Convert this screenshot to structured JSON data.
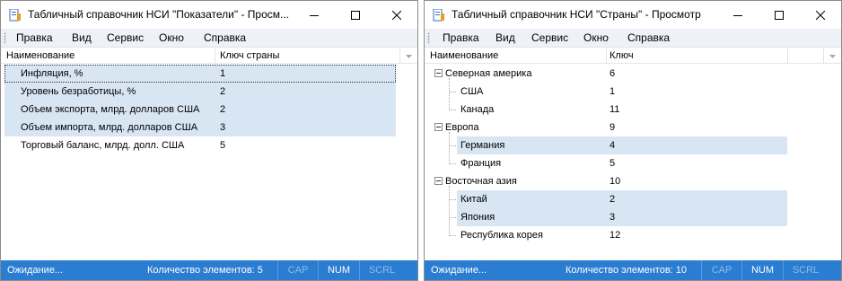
{
  "windows": [
    {
      "title": "Табличный справочник НСИ \"Показатели\" - Просм...",
      "menu": [
        "Правка",
        "Вид",
        "Сервис",
        "Окно",
        "Справка"
      ],
      "columns": [
        "Наименование",
        "Ключ страны"
      ],
      "rows": [
        {
          "name": "Инфляция, %",
          "key": "1"
        },
        {
          "name": "Уровень безработицы, %",
          "key": "2"
        },
        {
          "name": "Объем экспорта, млрд. долларов США",
          "key": "2"
        },
        {
          "name": "Объем импорта, млрд. долларов США",
          "key": "3"
        },
        {
          "name": "Торговый баланс, млрд. долл. США",
          "key": "5"
        }
      ],
      "status": "Ожидание...",
      "count": "Количество элементов: 5",
      "indicators": [
        "CAP",
        "NUM",
        "SCRL"
      ]
    },
    {
      "title": "Табличный справочник НСИ \"Страны\" - Просмотр",
      "menu": [
        "Правка",
        "Вид",
        "Сервис",
        "Окно",
        "Справка"
      ],
      "columns": [
        "Наименование",
        "Ключ"
      ],
      "rows": [
        {
          "name": "Северная америка",
          "key": "6"
        },
        {
          "name": "США",
          "key": "1"
        },
        {
          "name": "Канада",
          "key": "11"
        },
        {
          "name": "Европа",
          "key": "9"
        },
        {
          "name": "Германия",
          "key": "4"
        },
        {
          "name": "Франция",
          "key": "5"
        },
        {
          "name": "Восточная азия",
          "key": "10"
        },
        {
          "name": "Китай",
          "key": "2"
        },
        {
          "name": "Япония",
          "key": "3"
        },
        {
          "name": "Республика корея",
          "key": "12"
        }
      ],
      "status": "Ожидание...",
      "count": "Количество элементов: 10",
      "indicators": [
        "CAP",
        "NUM",
        "SCRL"
      ]
    }
  ]
}
